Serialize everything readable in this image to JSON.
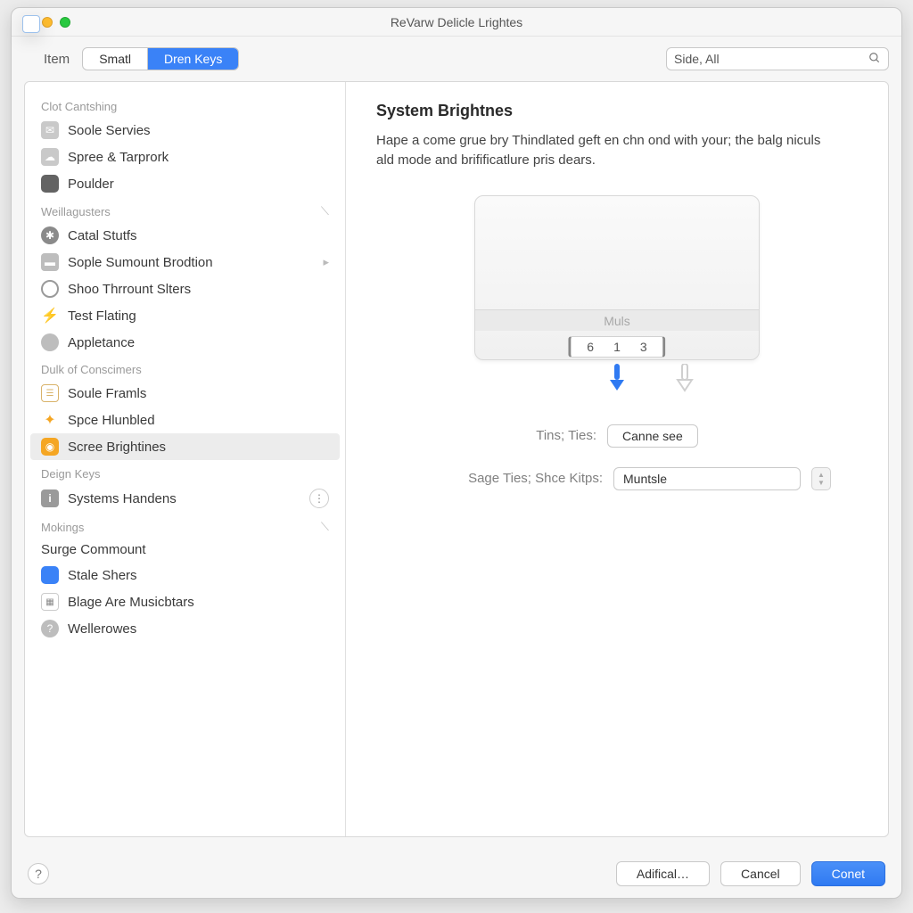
{
  "window": {
    "title": "ReVarw Delicle Lrightes"
  },
  "toolbar": {
    "item_label": "Item",
    "seg1": "Smatl",
    "seg2": "Dren Keys",
    "search_value": "Side, All"
  },
  "sidebar": {
    "groups": [
      {
        "header": "Clot Cantshing",
        "items": [
          {
            "label": "Soole Servies"
          },
          {
            "label": "Spree & Tarprork"
          },
          {
            "label": "Poulder"
          }
        ]
      },
      {
        "header": "Weillagusters",
        "collapsible": true,
        "items": [
          {
            "label": "Catal Stutfs"
          },
          {
            "label": "Sople Sumount Brodtion",
            "trailing": "play"
          },
          {
            "label": "Shoo Thrrount Slters"
          },
          {
            "label": "Test Flating"
          },
          {
            "label": "Appletance"
          }
        ]
      },
      {
        "header": "Dulk of Conscimers",
        "items": [
          {
            "label": "Soule Framls"
          },
          {
            "label": "Spce Hlunbled"
          },
          {
            "label": "Scree Brightines",
            "selected": true
          }
        ]
      },
      {
        "header": "Deign Keys",
        "items": [
          {
            "label": "Systems Handens",
            "trailing": "more"
          }
        ]
      },
      {
        "header": "Mokings",
        "collapsible": true,
        "items": [
          {
            "label": "Surge Commount"
          },
          {
            "label": "Stale Shers"
          },
          {
            "label": "Blage Are Musicbtars"
          },
          {
            "label": "Wellerowes"
          }
        ]
      }
    ]
  },
  "main": {
    "heading": "System Brightnes",
    "description": "Hape a come grue bry Thindlated geft en chn ond with your; the balg niculs ald mode and brifificatlure pris dears.",
    "preview_bar_label": "Muls",
    "keys": [
      "6",
      "1",
      "3"
    ],
    "row1_label": "Tins; Ties:",
    "row1_button": "Canne see",
    "row2_label": "Sage Ties; Shce Kitps:",
    "row2_value": "Muntsle"
  },
  "footer": {
    "help": "?",
    "btn1": "Adifical…",
    "btn2": "Cancel",
    "btn3": "Conet"
  }
}
